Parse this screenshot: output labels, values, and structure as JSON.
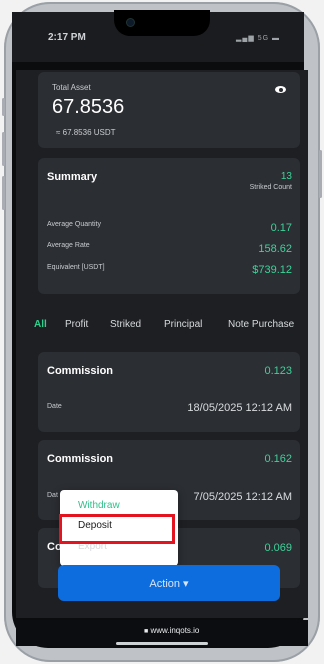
{
  "status_bar": {
    "time": "2:17 PM",
    "network": "5G"
  },
  "total_asset": {
    "label": "Total Asset",
    "value": "67.8536",
    "equivalent": "≈ 67.8536 USDT"
  },
  "summary": {
    "title": "Summary",
    "striked_count_value": "13",
    "striked_count_label": "Striked Count",
    "rows": [
      {
        "label": "Average Quantity",
        "value": "0.17"
      },
      {
        "label": "Average Rate",
        "value": "158.62"
      },
      {
        "label": "Equivalent [USDT]",
        "value": "$739.12"
      }
    ]
  },
  "tabs": [
    "All",
    "Profit",
    "Striked",
    "Principal",
    "Note Purchase"
  ],
  "records": [
    {
      "title": "Commission",
      "amount": "0.123",
      "date_label": "Date",
      "date": "18/05/2025 12:12 AM"
    },
    {
      "title": "Commission",
      "amount": "0.162",
      "date_label": "Dat",
      "date": "7/05/2025 12:12 AM"
    },
    {
      "title": "Co",
      "amount": "0.069"
    }
  ],
  "action_menu": {
    "items": [
      "Withdraw",
      "Deposit",
      "Export"
    ],
    "selected": "Deposit"
  },
  "action_button": {
    "label": "Action ▾"
  },
  "url": "www.inqots.io",
  "colors": {
    "accent_green": "#3ed39a",
    "action_blue": "#0d6ddf",
    "highlight_red": "#e3131f"
  }
}
